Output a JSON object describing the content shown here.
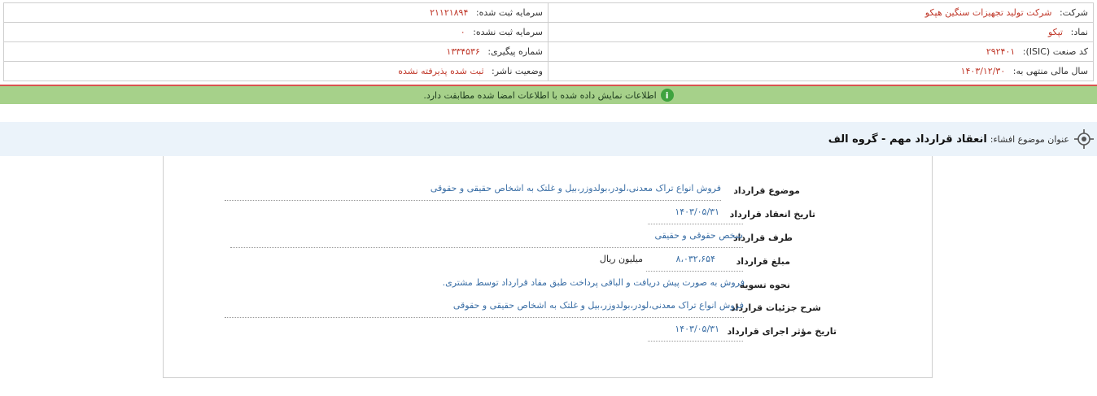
{
  "company_info": {
    "company_label": "شرکت:",
    "company_value": "شرکت تولید تجهیزات سنگین هپکو",
    "registered_capital_label": "سرمایه ثبت شده:",
    "registered_capital_value": "۲۱۱۲۱۸۹۴",
    "symbol_label": "نماد:",
    "symbol_value": "تپکو",
    "unregistered_capital_label": "سرمایه ثبت نشده:",
    "unregistered_capital_value": "۰",
    "isic_label": "کد صنعت (ISIC):",
    "isic_value": "۲۹۲۴۰۱",
    "tracking_label": "شماره پیگیری:",
    "tracking_value": "۱۳۳۴۵۳۶",
    "fiscal_year_label": "سال مالی منتهی به:",
    "fiscal_year_value": "۱۴۰۳/۱۲/۳۰",
    "publisher_status_label": "وضعیت ناشر:",
    "publisher_status_value": "ثبت شده پذیرفته نشده"
  },
  "verification": {
    "message": "اطلاعات نمایش داده شده با اطلاعات امضا شده مطابقت دارد."
  },
  "subject": {
    "label": "عنوان موضوع افشاء:",
    "value": "انعقاد قرارداد مهم - گروه الف"
  },
  "contract": {
    "subject_label": "موضوع قرارداد",
    "subject_value": "فروش انواع تراک معدنی،لودر،بولدوزر،بیل و غلتک به اشخاص حقیقی و حقوقی",
    "date_label": "تاریخ انعقاد قرارداد",
    "date_value": "۱۴۰۳/۰۵/۳۱",
    "party_label": "طرف قرارداد",
    "party_value": "شخص حقوقی و حقیقی",
    "amount_label": "مبلغ قرارداد",
    "amount_value": "۸،۰۳۲،۶۵۴",
    "amount_unit": "میلیون ریال",
    "settlement_label": "نحوه تسویه",
    "settlement_value": "فروش به صورت پیش دریافت و الباقی پرداخت طبق مفاد قرارداد توسط مشتری.",
    "details_label": "شرح جزئیات قرارداد",
    "details_value": "فروش انواع تراک معدنی،لودر،بولدوزر،بیل و غلتک به اشخاص حقیقی و حقوقی",
    "effective_date_label": "تاریخ مؤثر اجرای قرارداد",
    "effective_date_value": "۱۴۰۳/۰۵/۳۱"
  },
  "colors": {
    "value_red": "#c0392b",
    "value_blue": "#3a6ea5",
    "green_bar": "#a6d18a",
    "red_line": "#d9534f",
    "subject_bg": "#ebf3fa"
  }
}
